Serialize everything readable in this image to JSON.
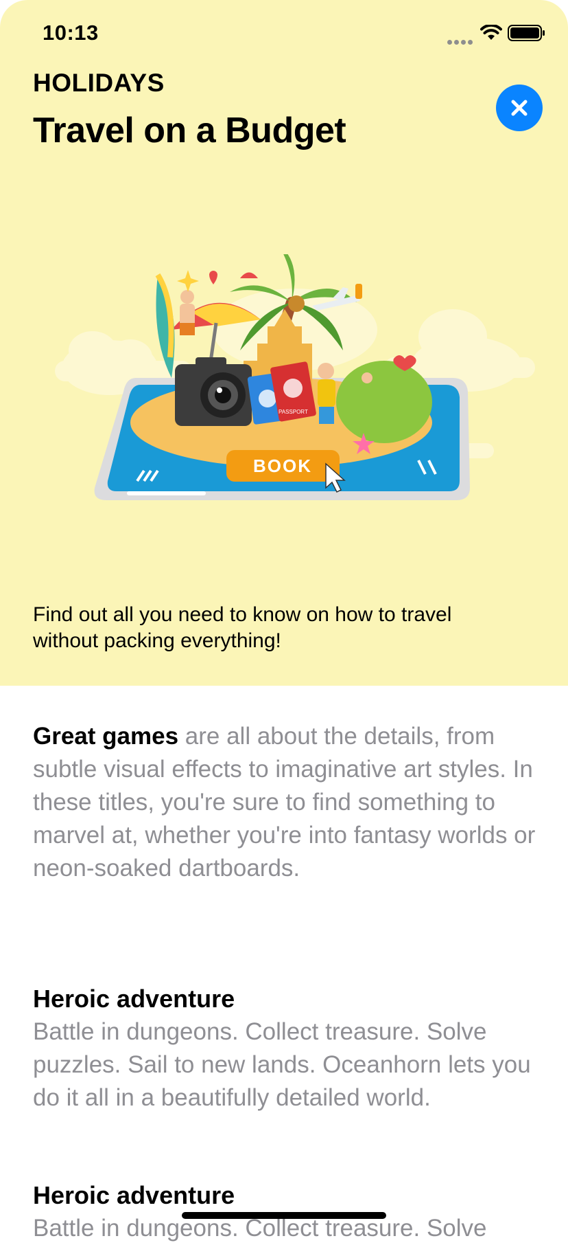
{
  "status_bar": {
    "time": "10:13"
  },
  "hero": {
    "category": "HOLIDAYS",
    "title": "Travel on a Budget",
    "button_text": "BOOK",
    "passport_text": "PASSPORT",
    "description": "Find out all you need to know on how to travel without packing everything!"
  },
  "article": {
    "intro_lead": "Great games",
    "intro_rest": " are all about the details, from subtle visual effects to imaginative art styles. In these titles, you're sure to find something to marvel at, whether you're into fantasy worlds or neon-soaked dartboards.",
    "sections": [
      {
        "heading": "Heroic adventure",
        "body": "Battle in dungeons. Collect treasure. Solve puzzles. Sail to new lands. Oceanhorn lets you do it all in a beautifully detailed world."
      },
      {
        "heading": "Heroic adventure",
        "body": "Battle in dungeons. Collect treasure. Solve"
      }
    ]
  },
  "colors": {
    "hero_bg": "#fbf5b7",
    "accent": "#0a84ff",
    "secondary_text": "#8e8e93"
  }
}
